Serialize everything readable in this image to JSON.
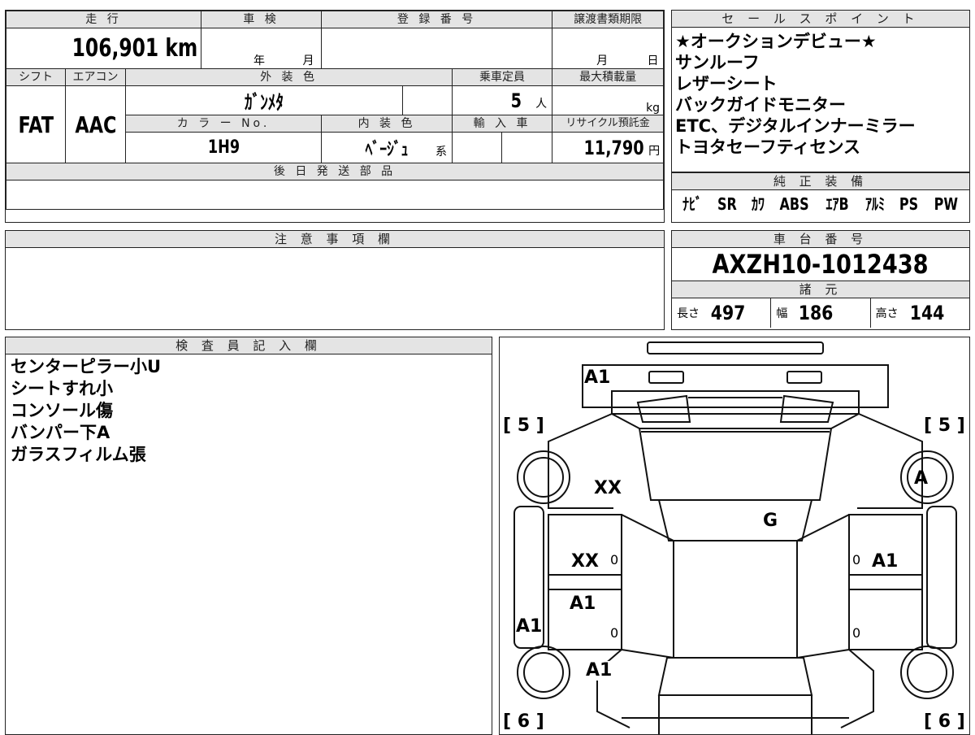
{
  "top": {
    "mileage_label": "走 行",
    "mileage": "106,901 km",
    "inspection_label": "車 検",
    "inspection_year": "年",
    "inspection_month": "月",
    "reg_label": "登 録 番 号",
    "deadline_label": "譲渡書類期限",
    "deadline_month": "月",
    "deadline_day": "日",
    "shift_label": "シフト",
    "ac_label": "エアコン",
    "exterior_label": "外 装 色",
    "capacity_label": "乗車定員",
    "maxload_label": "最大積載量",
    "shift": "FAT",
    "ac": "AAC",
    "exterior": "ｶﾞﾝﾒﾀ",
    "capacity": "5",
    "capacity_unit": "人",
    "maxload_unit": "kg",
    "colorno_label": "カ ラ ー No.",
    "interior_label": "内 装 色",
    "import_label": "輸 入 車",
    "recycle_label": "リサイクル預託金",
    "colorno": "1H9",
    "interior": "ﾍﾞｰｼﾞｭ",
    "interior_suffix": "系",
    "recycle": "11,790",
    "recycle_unit": "円",
    "later_parts_label": "後 日 発 送 部 品"
  },
  "sales": {
    "label": "セ ー ル ス ポ イ ン ト",
    "items": [
      "★オークションデビュー★",
      "サンルーフ",
      "レザーシート",
      "バックガイドモニター",
      "ETC、デジタルインナーミラー",
      "トヨタセーフティセンス"
    ]
  },
  "equipment": {
    "label": "純 正 装 備",
    "items": [
      "ﾅﾋﾞ",
      "SR",
      "ｶﾜ",
      "ABS",
      "ｴｱB",
      "ｱﾙﾐ",
      "PS",
      "PW"
    ]
  },
  "notes": {
    "label": "注 意 事 項 欄"
  },
  "chassis": {
    "label": "車 台 番 号",
    "number": "AXZH10-1012438",
    "specs_label": "諸 元",
    "length_label": "長さ",
    "length": "497",
    "width_label": "幅",
    "width": "186",
    "height_label": "高さ",
    "height": "144"
  },
  "inspector": {
    "label": "検 査 員 記 入 欄",
    "lines": [
      "センターピラー小U",
      "シートすれ小",
      "コンソール傷",
      "バンパー下A",
      "ガラスフィルム張"
    ]
  },
  "diagram": {
    "tire_fl": "5",
    "tire_fr": "5",
    "tire_rl": "6",
    "tire_rr": "6",
    "marks": {
      "front_bumper": "A1",
      "left_front_fender": "XX",
      "right_front_wheel": "A",
      "windshield": "G",
      "left_front_door": "XX",
      "left_front_door_zero": "0",
      "right_front_door_zero": "0",
      "right_front_door": "A1",
      "left_rear_door": "A1",
      "left_sill": "A1",
      "left_rear_door_zero": "0",
      "right_rear_door_zero": "0",
      "left_rear_fender": "A1"
    }
  }
}
